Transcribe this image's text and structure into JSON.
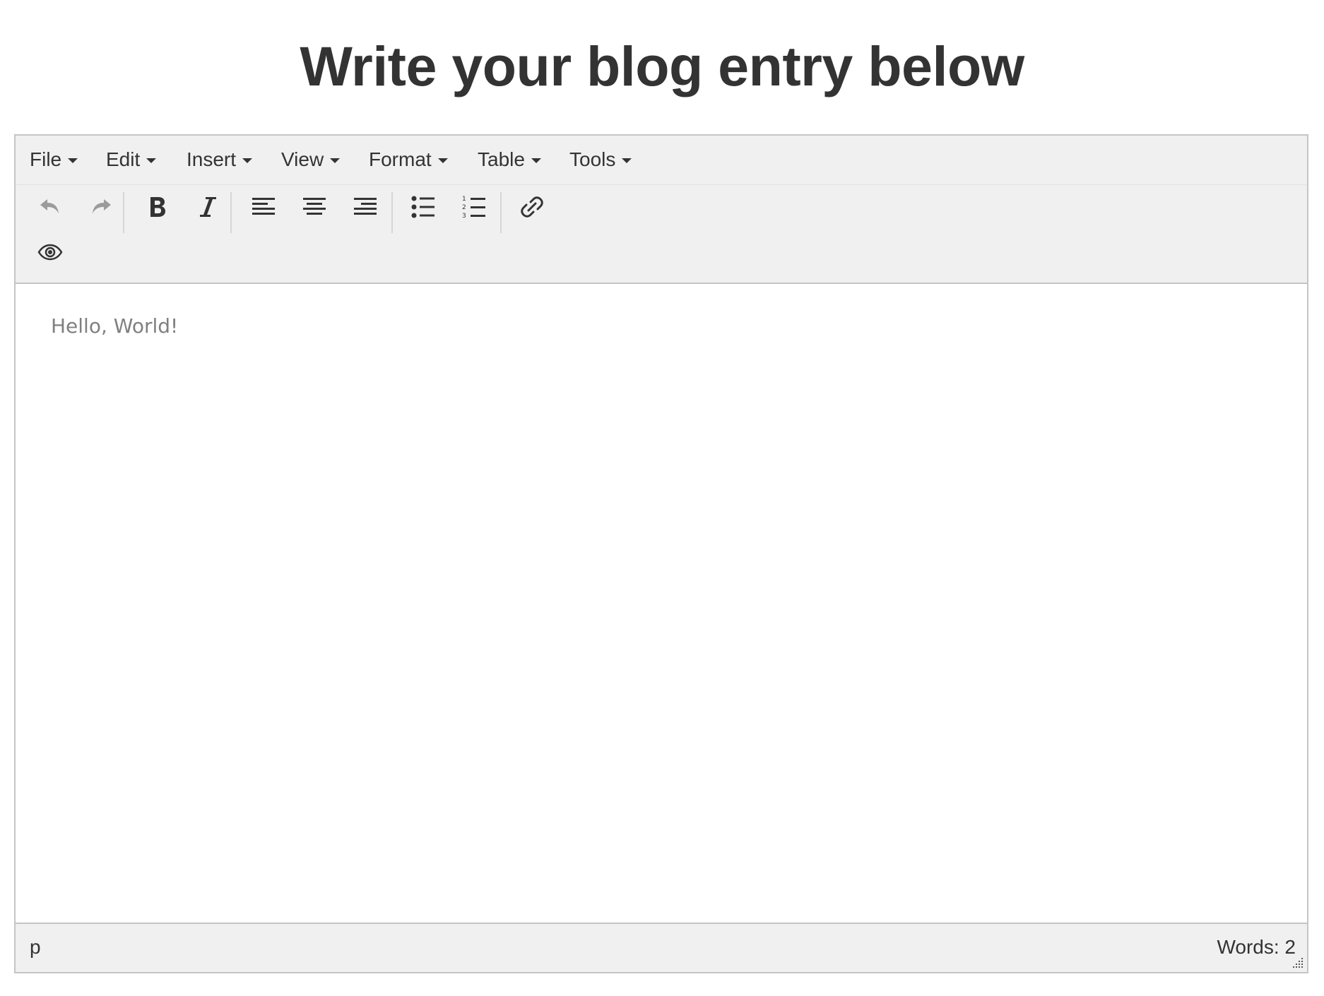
{
  "page": {
    "title": "Write your blog entry below"
  },
  "menubar": {
    "items": [
      {
        "label": "File"
      },
      {
        "label": "Edit"
      },
      {
        "label": "Insert"
      },
      {
        "label": "View"
      },
      {
        "label": "Format"
      },
      {
        "label": "Table"
      },
      {
        "label": "Tools"
      }
    ]
  },
  "toolbar": {
    "buttons": [
      {
        "icon": "undo-icon",
        "enabled": false
      },
      {
        "icon": "redo-icon",
        "enabled": false
      },
      {
        "icon": "bold-icon",
        "enabled": true
      },
      {
        "icon": "italic-icon",
        "enabled": true
      },
      {
        "icon": "align-left-icon",
        "enabled": true
      },
      {
        "icon": "align-center-icon",
        "enabled": true
      },
      {
        "icon": "align-right-icon",
        "enabled": true
      },
      {
        "icon": "bullet-list-icon",
        "enabled": true
      },
      {
        "icon": "numbered-list-icon",
        "enabled": true
      },
      {
        "icon": "link-icon",
        "enabled": true
      },
      {
        "icon": "preview-eye-icon",
        "enabled": true
      }
    ]
  },
  "editor": {
    "content": "Hello, World!"
  },
  "statusbar": {
    "path": "p",
    "word_count_label": "Words:",
    "word_count": "2"
  },
  "colors": {
    "text": "#333333",
    "disabled": "#9b9b9b",
    "chrome_bg": "#f0f0f0",
    "border": "#c5c5c5",
    "content_text": "#808080"
  }
}
